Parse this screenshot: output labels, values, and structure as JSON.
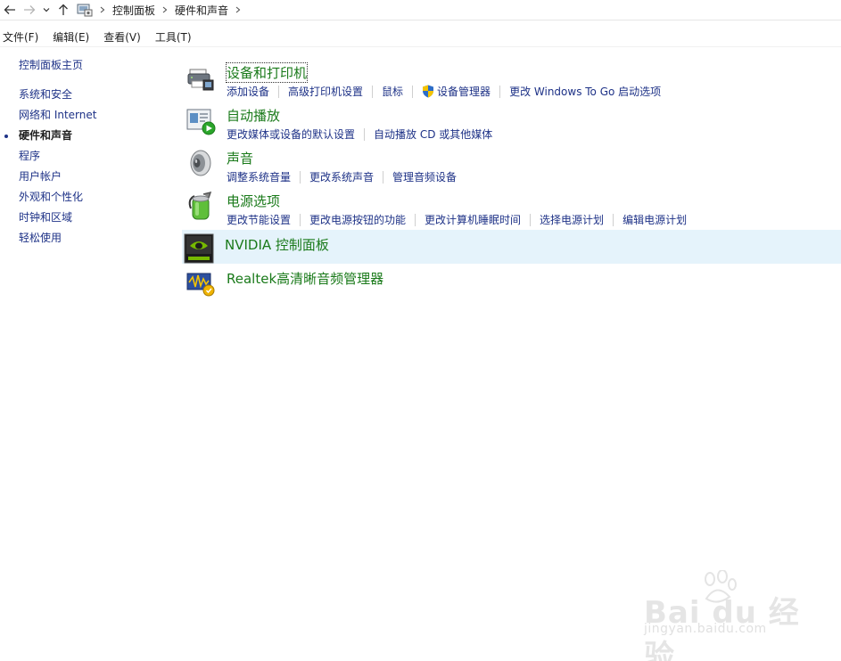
{
  "nav": {
    "back": "back-arrow-icon",
    "forward": "forward-arrow-icon",
    "recent": "chevron-down-icon",
    "up": "up-arrow-icon"
  },
  "breadcrumb": {
    "items": [
      "控制面板",
      "硬件和声音"
    ]
  },
  "menu": {
    "items": [
      "文件(F)",
      "编辑(E)",
      "查看(V)",
      "工具(T)"
    ]
  },
  "sidebar": {
    "home": "控制面板主页",
    "items": [
      {
        "label": "系统和安全",
        "current": false
      },
      {
        "label": "网络和 Internet",
        "current": false
      },
      {
        "label": "硬件和声音",
        "current": true
      },
      {
        "label": "程序",
        "current": false
      },
      {
        "label": "用户帐户",
        "current": false
      },
      {
        "label": "外观和个性化",
        "current": false
      },
      {
        "label": "时钟和区域",
        "current": false
      },
      {
        "label": "轻松使用",
        "current": false
      }
    ]
  },
  "categories": [
    {
      "title": "设备和打印机",
      "icon": "printer-icon",
      "links": [
        "添加设备",
        "高级打印机设置",
        "鼠标",
        "设备管理器",
        "更改 Windows To Go 启动选项"
      ]
    },
    {
      "title": "自动播放",
      "icon": "autoplay-icon",
      "links": [
        "更改媒体或设备的默认设置",
        "自动播放 CD 或其他媒体"
      ]
    },
    {
      "title": "声音",
      "icon": "speaker-icon",
      "links": [
        "调整系统音量",
        "更改系统声音",
        "管理音频设备"
      ]
    },
    {
      "title": "电源选项",
      "icon": "battery-icon",
      "links": [
        "更改节能设置",
        "更改电源按钮的功能",
        "更改计算机睡眠时间",
        "选择电源计划",
        "编辑电源计划"
      ]
    },
    {
      "title": "NVIDIA 控制面板",
      "icon": "nvidia-icon",
      "links": []
    },
    {
      "title": "Realtek高清晰音频管理器",
      "icon": "realtek-audio-icon",
      "links": []
    }
  ],
  "colors": {
    "link": "#1e3287",
    "category_title": "#1a7a1a",
    "highlight": "#e5f3fb"
  },
  "watermark": {
    "text": "Bai du 经验",
    "url": "jingyan.baidu.com"
  }
}
